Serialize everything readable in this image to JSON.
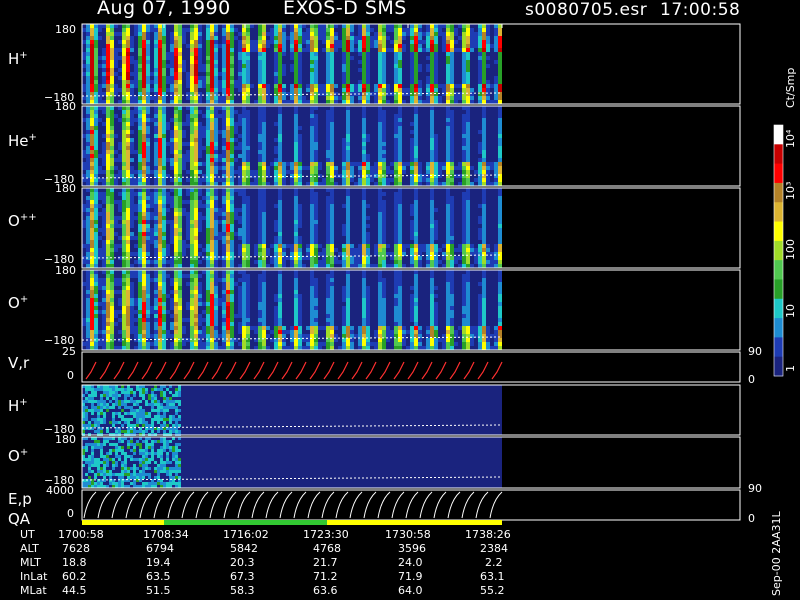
{
  "header": {
    "date": "Aug 07, 1990",
    "instrument": "EXOS-D SMS",
    "file": "s0080705.esr",
    "time": "17:00:58"
  },
  "panels": [
    {
      "id": "h-plus",
      "label": "H",
      "sup": "+",
      "top_tick": "180",
      "bottom_tick": "−180"
    },
    {
      "id": "he-plus",
      "label": "He",
      "sup": "+",
      "top_tick": "180",
      "bottom_tick": "−180"
    },
    {
      "id": "o-plusplus",
      "label": "O",
      "sup": "++",
      "top_tick": "180",
      "bottom_tick": "−180"
    },
    {
      "id": "o-plus",
      "label": "O",
      "sup": "+",
      "top_tick": "",
      "bottom_tick": "−180"
    },
    {
      "id": "vr",
      "label": "V,r",
      "sup": "",
      "top_tick": "25",
      "bottom_tick": "0",
      "right_top": "90",
      "right_bottom": "0"
    },
    {
      "id": "h-plus-2",
      "label": "H",
      "sup": "+",
      "top_tick": "",
      "bottom_tick": "−180"
    },
    {
      "id": "o-plus-2",
      "label": "O",
      "sup": "+",
      "top_tick": "180",
      "bottom_tick": "−180"
    },
    {
      "id": "ep",
      "label": "E,p",
      "sup": "",
      "top_tick": "4000",
      "bottom_tick": "0",
      "right_top": "90",
      "right_bottom": "0"
    }
  ],
  "qa_label": "QA",
  "colorbar": {
    "unit": "Ct/Smp",
    "ticks": [
      "1",
      "10",
      "100",
      "10³",
      "10⁴"
    ]
  },
  "side_text": "Sep-00 2AA31L",
  "footer": {
    "rows": [
      {
        "name": "UT",
        "values": [
          "1700:58",
          "1708:34",
          "1716:02",
          "1723:30",
          "1730:58",
          "1738:26"
        ]
      },
      {
        "name": "ALT",
        "values": [
          "7628",
          "6794",
          "5842",
          "4768",
          "3596",
          "2384"
        ]
      },
      {
        "name": "MLT",
        "values": [
          "18.8",
          "19.4",
          "20.3",
          "21.7",
          "24.0",
          "2.2"
        ]
      },
      {
        "name": "InLat",
        "values": [
          "60.2",
          "63.5",
          "67.3",
          "71.2",
          "71.9",
          "63.1"
        ]
      },
      {
        "name": "MLat",
        "values": [
          "44.5",
          "51.5",
          "58.3",
          "63.6",
          "64.0",
          "55.2"
        ]
      }
    ]
  },
  "chart_data": {
    "type": "heatmap",
    "title": "Aug 07, 1990 EXOS-D SMS",
    "xlabel": "UT",
    "x_ticks": [
      "1700:58",
      "1708:34",
      "1716:02",
      "1723:30",
      "1730:58",
      "1738:26"
    ],
    "colorscale": [
      "#1a237e",
      "#1e3cb4",
      "#1e8cd2",
      "#1ec8c8",
      "#28a028",
      "#50c850",
      "#a0dc28",
      "#ffff00",
      "#dcb432",
      "#b48228",
      "#ff0000",
      "#c80000",
      "#ffffff"
    ],
    "colorbar_range": [
      1,
      10000
    ],
    "series": [
      {
        "name": "H+",
        "ylim": [
          -180,
          180
        ]
      },
      {
        "name": "He+",
        "ylim": [
          -180,
          180
        ]
      },
      {
        "name": "O++",
        "ylim": [
          -180,
          180
        ]
      },
      {
        "name": "O+",
        "ylim": [
          -180,
          180
        ]
      },
      {
        "name": "V,r",
        "ylim": [
          0,
          25
        ]
      },
      {
        "name": "H+",
        "ylim": [
          -180,
          180
        ]
      },
      {
        "name": "O+",
        "ylim": [
          -180,
          180
        ]
      },
      {
        "name": "E,p",
        "ylim": [
          0,
          4000
        ]
      }
    ],
    "qa_segments": [
      {
        "from": "1700:58",
        "to": "1708:34",
        "color": "#ffff00"
      },
      {
        "from": "1708:34",
        "to": "1723:30",
        "color": "#32c832"
      },
      {
        "from": "1723:30",
        "to": "1738:26",
        "color": "#ffff00"
      }
    ]
  }
}
